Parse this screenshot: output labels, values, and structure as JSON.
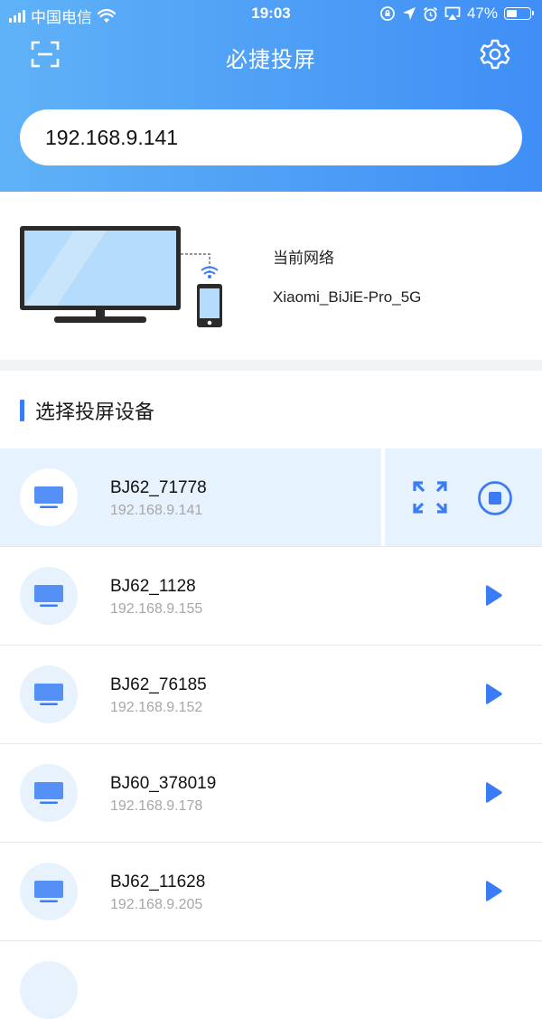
{
  "status_bar": {
    "carrier": "中国电信",
    "time": "19:03",
    "battery": "47%",
    "battery_level": 0.47
  },
  "header": {
    "title": "必捷投屏",
    "left_icon": "scan-icon",
    "right_icon": "gear-icon"
  },
  "ip_input": {
    "value": "192.168.9.141"
  },
  "network": {
    "label": "当前网络",
    "ssid": "Xiaomi_BiJiE-Pro_5G"
  },
  "section": {
    "title": "选择投屏设备"
  },
  "devices": [
    {
      "name": "BJ62_71778",
      "ip": "192.168.9.141",
      "state": "casting"
    },
    {
      "name": "BJ62_1128",
      "ip": "192.168.9.155",
      "state": "idle"
    },
    {
      "name": "BJ62_76185",
      "ip": "192.168.9.152",
      "state": "idle"
    },
    {
      "name": "BJ60_378019",
      "ip": "192.168.9.178",
      "state": "idle"
    },
    {
      "name": "BJ62_11628",
      "ip": "192.168.9.205",
      "state": "idle"
    }
  ],
  "colors": {
    "accent": "#3b7bf6",
    "header_start": "#5fb2f7",
    "header_end": "#3f8ef6",
    "active_row": "#e6f2fd",
    "secondary_text": "#a7a7a7"
  }
}
